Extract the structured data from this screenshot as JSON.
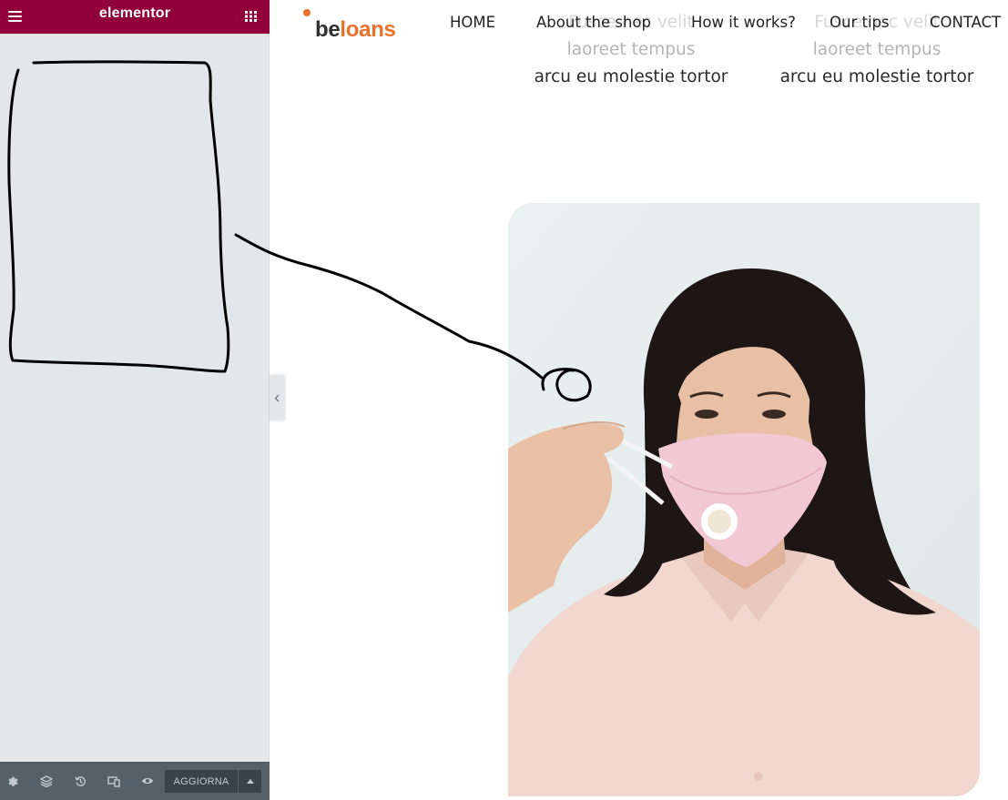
{
  "editor": {
    "title": "elementor",
    "footer": {
      "tools": [
        {
          "name": "settings",
          "icon": "gear-icon"
        },
        {
          "name": "navigator",
          "icon": "layers-icon"
        },
        {
          "name": "history",
          "icon": "history-icon"
        },
        {
          "name": "responsive-mode",
          "icon": "responsive-icon"
        },
        {
          "name": "preview",
          "icon": "eye-icon"
        }
      ],
      "update_label": "AGGIORNA"
    }
  },
  "site": {
    "logo": {
      "part1": "be",
      "part2": "loans"
    },
    "nav": [
      "HOME",
      "About the shop",
      "How it works?",
      "Our tips",
      "CONTACT"
    ],
    "features": [
      {
        "line1": "Fusce nec velit",
        "line2": "laoreet tempus",
        "line3": "arcu eu molestie",
        "line4": "tortor"
      },
      {
        "line1": "Fusce nec velit",
        "line2": "laoreet tempus",
        "line3": "arcu eu molestie",
        "line4": "tortor"
      }
    ],
    "hero_image": "woman adjusting pink face mask"
  },
  "colors": {
    "editor_brand": "#92003b",
    "panel_bg": "#e4e7ea",
    "footer_bg": "#556068",
    "logo_accent": "#e8712c"
  }
}
